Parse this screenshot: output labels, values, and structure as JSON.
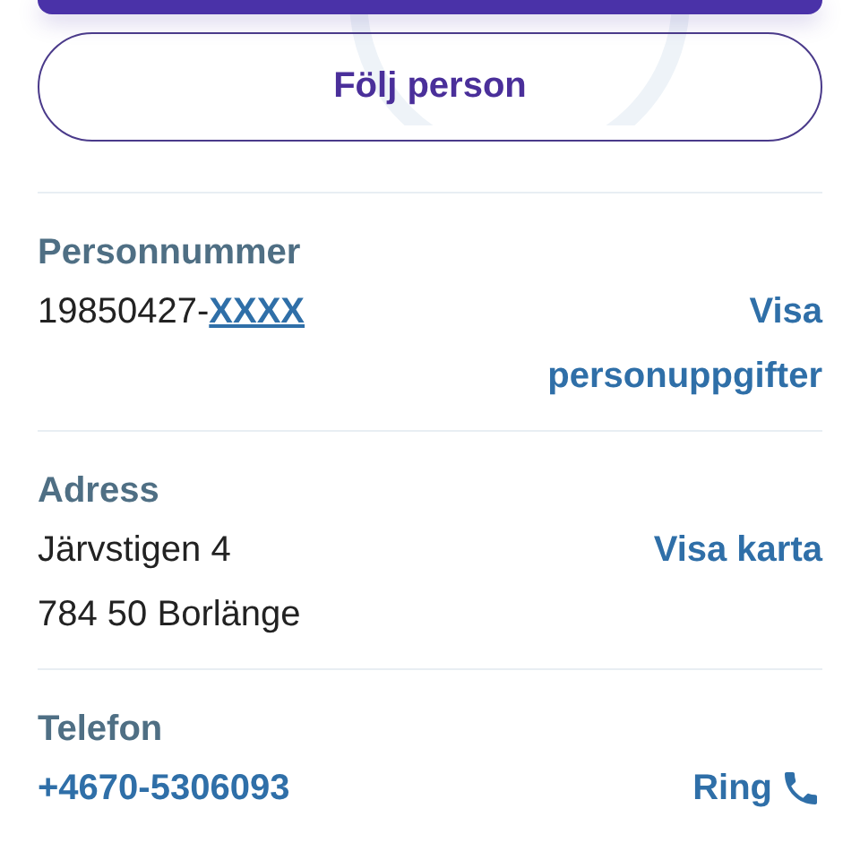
{
  "follow_button": {
    "label": "Följ person"
  },
  "sections": [
    {
      "label": "Personnummer",
      "lines": [
        [
          {
            "text": "19850427-",
            "kind": "plain"
          },
          {
            "text": "XXXX",
            "kind": "masked"
          }
        ]
      ],
      "action": {
        "label": "Visa personuppgifter",
        "kind": "text"
      }
    },
    {
      "label": "Adress",
      "lines": [
        [
          {
            "text": "Järvstigen 4",
            "kind": "plain"
          }
        ],
        [
          {
            "text": "784 50 Borlänge",
            "kind": "plain"
          }
        ]
      ],
      "action": {
        "label": "Visa karta",
        "kind": "text"
      }
    },
    {
      "label": "Telefon",
      "lines": [
        [
          {
            "text": "+4670-5306093",
            "kind": "link"
          }
        ]
      ],
      "action": {
        "label": "Ring",
        "kind": "phone"
      }
    }
  ]
}
